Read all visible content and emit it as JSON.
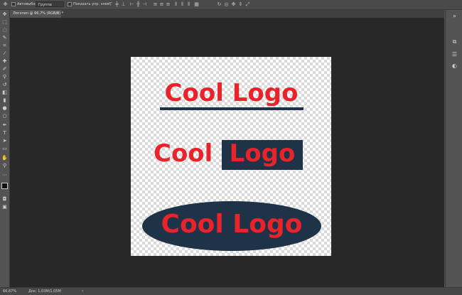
{
  "options_bar": {
    "home_icon": "move-tool-icon",
    "autoselect_label": "Автовыбор:",
    "autoselect_value": "Группа",
    "transform_label": "Показать упр. элем."
  },
  "document": {
    "tab_title": "Логотип @ 66,7% (RGB/8) *",
    "close": "×"
  },
  "canvas": {
    "logo1_text": "Cool Logo",
    "logo2_part1": "Cool",
    "logo2_part2": "Logo",
    "logo3_text": "Cool Logo",
    "colors": {
      "text_red": "#e8232b",
      "shape_navy": "#1e3347",
      "workspace": "#282828"
    }
  },
  "status_bar": {
    "zoom": "66,67%",
    "doc_info": "Док: 1,03M/1,05M",
    "arrow": "›"
  }
}
